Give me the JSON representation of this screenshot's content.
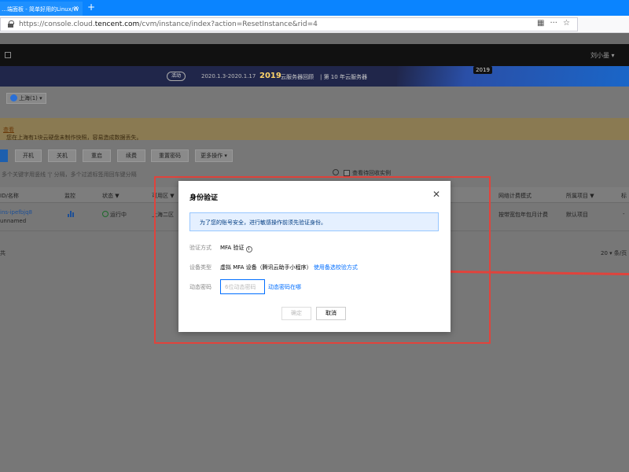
{
  "browser": {
    "tab_title": "…端面板 - 简单好用的Linux/W",
    "tab_close": "✕",
    "new_tab": "+",
    "url_prefix": "https://console.cloud.",
    "url_domain": "tencent.com",
    "url_path": "/cvm/instance/index?action=ResetInstance&rid=4",
    "icons": [
      "qr-code-icon",
      "more-icon",
      "star-icon"
    ]
  },
  "console_header": {
    "user": "刘小墨 ▾"
  },
  "banner": {
    "pill": "活动",
    "dates": "2020.1.3-2020.1.17",
    "year": "2019",
    "promo1": "云服务器回顾",
    "promo2": "| 第 10 年云服务器",
    "badge": "2019"
  },
  "page": {
    "region": "上海(1) ▾",
    "notice": "您在上海有1块云硬盘未制作快照，容易造成数据丢失。",
    "notice_link": "查看",
    "toolbar": [
      "开机",
      "关机",
      "重启",
      "续费",
      "重置密码",
      "更多操作 ▾"
    ],
    "search_placeholder": "多个关键字用竖线 '|' 分隔，多个过滤标签用回车键分隔",
    "show_isolated": "查看待回收实例",
    "columns": [
      "ID/名称",
      "监控",
      "状态 ▼",
      "可用区 ▼",
      "网络计费模式",
      "所属项目 ▼",
      "标"
    ],
    "row": {
      "id": "ins-ipefbjq8",
      "name": "unnamed",
      "status": "运行中",
      "zone": "上海二区",
      "billing": "按带宽包年包月计费",
      "project": "默认项目",
      "tag": "-"
    },
    "total_prefix": "共",
    "pager": "20 ▾  条/页"
  },
  "modal": {
    "title": "身份验证",
    "close": "✕",
    "info": "为了您的账号安全，进行敏感操作前须先验证身份。",
    "method_label": "验证方式",
    "method_value": "MFA 验证",
    "device_label": "设备类型",
    "device_value": "虚拟 MFA 设备（腾讯云助手小程序）",
    "device_link": "使用备选校验方式",
    "code_label": "动态密码",
    "code_placeholder": "6位动态密码",
    "code_link": "动态密码在哪",
    "ok": "确定",
    "cancel": "取消"
  },
  "annotation": {
    "color": "#e0433c"
  }
}
